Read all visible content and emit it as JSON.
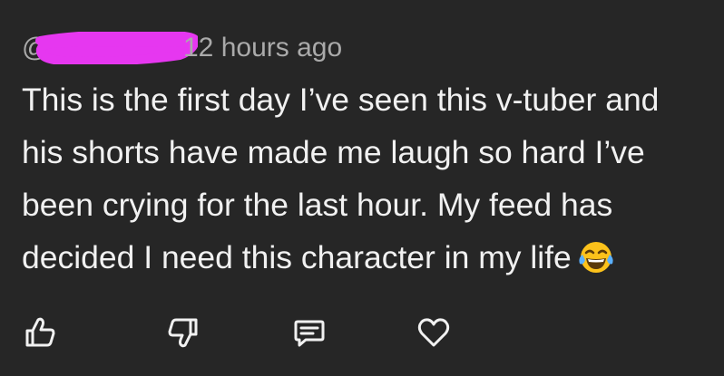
{
  "comment": {
    "handle_prefix": "@",
    "timestamp": "12 hours ago",
    "lines": [
      "This is the first day I’ve seen this v-tuber and",
      "his shorts have made me laugh so hard I’ve",
      "been crying for the last hour. My feed has",
      "decided I need this character in my life"
    ],
    "emoji": "face-with-tears-of-joy",
    "redaction_color": "#e637f0"
  },
  "actions": [
    {
      "name": "like-button",
      "icon": "thumbs-up-icon"
    },
    {
      "name": "dislike-button",
      "icon": "thumbs-down-icon"
    },
    {
      "name": "reply-button",
      "icon": "comment-icon"
    },
    {
      "name": "heart-button",
      "icon": "heart-icon"
    }
  ],
  "colors": {
    "background": "#262626",
    "text": "#f1f1f1",
    "meta_text": "#aaaaaa"
  }
}
